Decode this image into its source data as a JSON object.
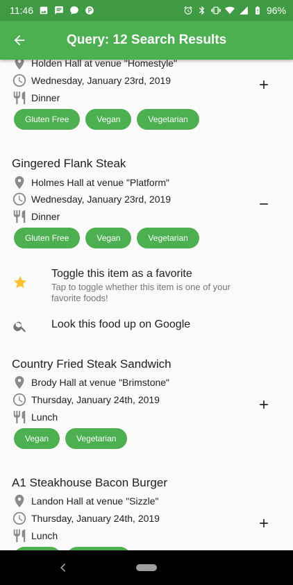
{
  "status_bar": {
    "time": "11:46",
    "battery": "96%",
    "left_icons": [
      "image-icon",
      "message-icon",
      "chat-bubble-icon",
      "p-icon"
    ],
    "right_icons": [
      "alarm-icon",
      "bluetooth-icon",
      "vibrate-icon",
      "wifi-icon",
      "signal-icon",
      "battery-icon"
    ]
  },
  "app_bar": {
    "title": "Query: 12 Search Results",
    "color": "#4caf50"
  },
  "items": [
    {
      "location": "Holden Hall at venue \"Homestyle\"",
      "date": "Wednesday, January 23rd, 2019",
      "meal": "Dinner",
      "tags": [
        "Gluten Free",
        "Vegan",
        "Vegetarian"
      ],
      "expanded": false
    },
    {
      "title": "Gingered Flank Steak",
      "location": "Holmes Hall at venue \"Platform\"",
      "date": "Wednesday, January 23rd, 2019",
      "meal": "Dinner",
      "tags": [
        "Gluten Free",
        "Vegan",
        "Vegetarian"
      ],
      "expanded": true,
      "actions": {
        "favorite_title": "Toggle this item as a favorite",
        "favorite_subtitle": "Tap to toggle whether this item is one of your favorite foods!",
        "google_title": "Look this food up on Google"
      }
    },
    {
      "title": "Country Fried Steak Sandwich",
      "location": "Brody Hall at venue \"Brimstone\"",
      "date": "Thursday, January 24th, 2019",
      "meal": "Lunch",
      "tags": [
        "Vegan",
        "Vegetarian"
      ],
      "expanded": false
    },
    {
      "title": "A1 Steakhouse Bacon Burger",
      "location": "Landon Hall at venue \"Sizzle\"",
      "date": "Thursday, January 24th, 2019",
      "meal": "Lunch",
      "tags": [
        "",
        ""
      ],
      "expanded": false
    }
  ]
}
